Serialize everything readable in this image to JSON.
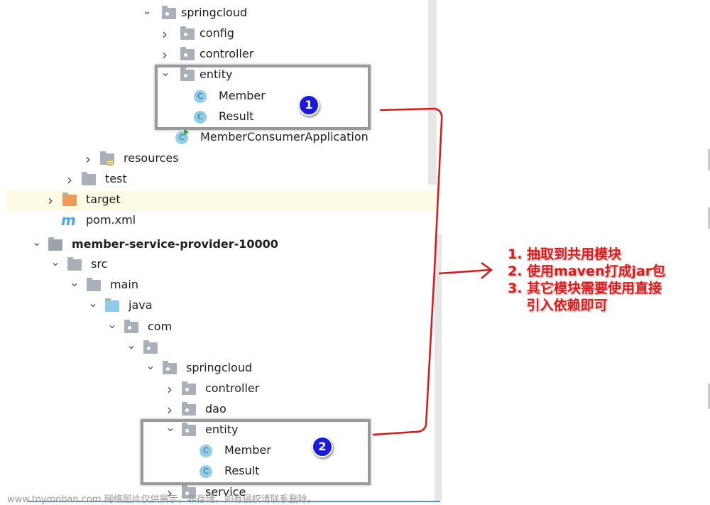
{
  "tree": [
    {
      "label": "springcloud",
      "type": "package",
      "state": "expanded"
    },
    {
      "label": "config",
      "type": "package",
      "state": "collapsed"
    },
    {
      "label": "controller",
      "type": "package",
      "state": "collapsed"
    },
    {
      "label": "entity",
      "type": "package",
      "state": "expanded"
    },
    {
      "label": "Member",
      "type": "class"
    },
    {
      "label": "Result",
      "type": "class"
    },
    {
      "label": "MemberConsumerApplication",
      "type": "spring-boot-class"
    },
    {
      "label": "resources",
      "type": "resources-folder",
      "state": "collapsed"
    },
    {
      "label": "test",
      "type": "folder",
      "state": "collapsed"
    },
    {
      "label": "target",
      "type": "excluded-folder",
      "state": "collapsed",
      "highlighted": true
    },
    {
      "label": "pom.xml",
      "type": "maven-file"
    },
    {
      "label": "member-service-provider-10000",
      "type": "module",
      "state": "expanded"
    },
    {
      "label": "src",
      "type": "folder",
      "state": "expanded"
    },
    {
      "label": "main",
      "type": "folder",
      "state": "expanded"
    },
    {
      "label": "java",
      "type": "source-folder",
      "state": "expanded"
    },
    {
      "label": "com",
      "type": "package",
      "state": "expanded"
    },
    {
      "label": "",
      "type": "package",
      "state": "expanded"
    },
    {
      "label": "springcloud",
      "type": "package",
      "state": "expanded"
    },
    {
      "label": "controller",
      "type": "package",
      "state": "collapsed"
    },
    {
      "label": "dao",
      "type": "package",
      "state": "collapsed"
    },
    {
      "label": "entity",
      "type": "package",
      "state": "expanded"
    },
    {
      "label": "Member",
      "type": "class"
    },
    {
      "label": "Result",
      "type": "class"
    },
    {
      "label": "service",
      "type": "package",
      "state": "collapsed"
    }
  ],
  "class_icon_letter": "C",
  "maven_icon_letter": "m",
  "badges": [
    "1",
    "2"
  ],
  "annotation": {
    "lines": [
      "1. 抽取到共用模块",
      "2. 使用maven打成jar包",
      "3. 其它模块需要使用直接",
      "    引入依赖即可"
    ],
    "color": "#e01818"
  },
  "watermark": "www.toymoban.com 网络图片仅供展示，非存储，如有侵权请联系删除。",
  "colors": {
    "badge": "#1b1bd8",
    "arrow": "#d81818",
    "highlight": "#fdfbe3",
    "folder": "#a9b1b8",
    "target_folder": "#ee9a5a",
    "java_folder": "#8ecbea"
  }
}
